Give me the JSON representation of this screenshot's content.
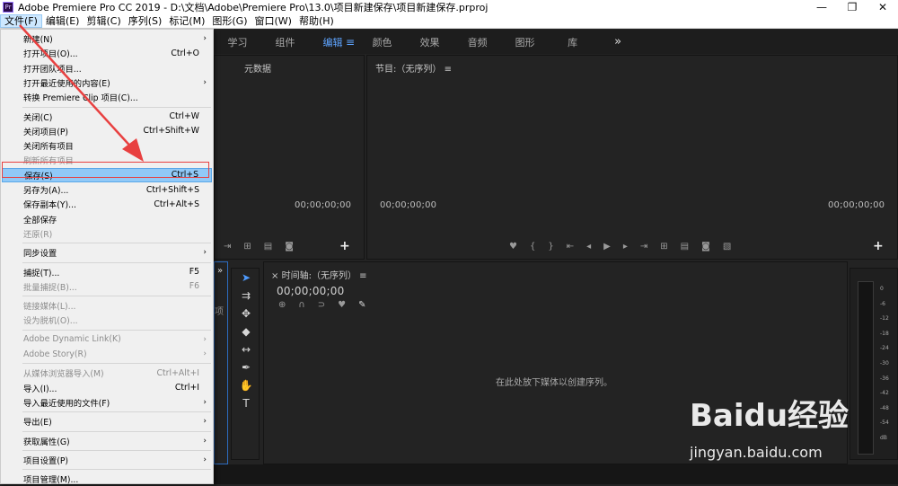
{
  "window": {
    "logo": "Pr",
    "title": "Adobe Premiere Pro CC 2019 - D:\\文档\\Adobe\\Premiere Pro\\13.0\\项目新建保存\\项目新建保存.prproj",
    "controls": [
      "—",
      "❐",
      "✕"
    ]
  },
  "menubar": [
    "文件(F)",
    "编辑(E)",
    "剪辑(C)",
    "序列(S)",
    "标记(M)",
    "图形(G)",
    "窗口(W)",
    "帮助(H)"
  ],
  "workspaces": {
    "tabs": [
      "学习",
      "组件",
      "编辑",
      "颜色",
      "效果",
      "音频",
      "图形",
      "库"
    ],
    "active": "编辑",
    "menu_icon": "≡",
    "more": "»"
  },
  "panels": {
    "source_tab": "元数据",
    "source_timecode": "00;00;00;00",
    "program_tab": "节目:（无序列）",
    "program_tab_menu": "≡",
    "program_timecode_left": "00;00;00;00",
    "program_timecode_right": "00;00;00;00",
    "timeline_close": "×",
    "timeline_tab": "时间轴:（无序列）",
    "timeline_tab_menu": "≡",
    "timeline_timecode": "00;00;00;00",
    "timeline_empty_text": "在此处放下媒体以创建序列。",
    "project_panel_more": "»",
    "project_panel_partial": "项",
    "add_button": "+"
  },
  "meter_scale": [
    "0",
    "-6",
    "-12",
    "-18",
    "-24",
    "-30",
    "-36",
    "-42",
    "-48",
    "-54",
    "dB"
  ],
  "file_menu": [
    {
      "label": "新建(N)",
      "shortcut": "",
      "submenu": true,
      "disabled": false
    },
    {
      "label": "打开项目(O)...",
      "shortcut": "Ctrl+O",
      "submenu": false,
      "disabled": false
    },
    {
      "label": "打开团队项目...",
      "shortcut": "",
      "submenu": false,
      "disabled": false
    },
    {
      "label": "打开最近使用的内容(E)",
      "shortcut": "",
      "submenu": true,
      "disabled": false
    },
    {
      "label": "转换 Premiere Clip 项目(C)...",
      "shortcut": "",
      "submenu": false,
      "disabled": false
    },
    {
      "sep": true
    },
    {
      "label": "关闭(C)",
      "shortcut": "Ctrl+W",
      "submenu": false,
      "disabled": false
    },
    {
      "label": "关闭项目(P)",
      "shortcut": "Ctrl+Shift+W",
      "submenu": false,
      "disabled": false
    },
    {
      "label": "关闭所有项目",
      "shortcut": "",
      "submenu": false,
      "disabled": false
    },
    {
      "label": "刷新所有项目",
      "shortcut": "",
      "submenu": false,
      "disabled": true
    },
    {
      "label": "保存(S)",
      "shortcut": "Ctrl+S",
      "submenu": false,
      "disabled": false,
      "highlight": true
    },
    {
      "label": "另存为(A)...",
      "shortcut": "Ctrl+Shift+S",
      "submenu": false,
      "disabled": false
    },
    {
      "label": "保存副本(Y)...",
      "shortcut": "Ctrl+Alt+S",
      "submenu": false,
      "disabled": false
    },
    {
      "label": "全部保存",
      "shortcut": "",
      "submenu": false,
      "disabled": false
    },
    {
      "label": "还原(R)",
      "shortcut": "",
      "submenu": false,
      "disabled": true
    },
    {
      "sep": true
    },
    {
      "label": "同步设置",
      "shortcut": "",
      "submenu": true,
      "disabled": false
    },
    {
      "sep": true
    },
    {
      "label": "捕捉(T)...",
      "shortcut": "F5",
      "submenu": false,
      "disabled": false
    },
    {
      "label": "批量捕捉(B)...",
      "shortcut": "F6",
      "submenu": false,
      "disabled": true
    },
    {
      "sep": true
    },
    {
      "label": "链接媒体(L)...",
      "shortcut": "",
      "submenu": false,
      "disabled": true
    },
    {
      "label": "设为脱机(O)...",
      "shortcut": "",
      "submenu": false,
      "disabled": true
    },
    {
      "sep": true
    },
    {
      "label": "Adobe Dynamic Link(K)",
      "shortcut": "",
      "submenu": true,
      "disabled": true
    },
    {
      "label": "Adobe Story(R)",
      "shortcut": "",
      "submenu": true,
      "disabled": true
    },
    {
      "sep": true
    },
    {
      "label": "从媒体浏览器导入(M)",
      "shortcut": "Ctrl+Alt+I",
      "submenu": false,
      "disabled": true
    },
    {
      "label": "导入(I)...",
      "shortcut": "Ctrl+I",
      "submenu": false,
      "disabled": false
    },
    {
      "label": "导入最近使用的文件(F)",
      "shortcut": "",
      "submenu": true,
      "disabled": false
    },
    {
      "sep": true
    },
    {
      "label": "导出(E)",
      "shortcut": "",
      "submenu": true,
      "disabled": false
    },
    {
      "sep": true
    },
    {
      "label": "获取属性(G)",
      "shortcut": "",
      "submenu": true,
      "disabled": false
    },
    {
      "sep": true
    },
    {
      "label": "项目设置(P)",
      "shortcut": "",
      "submenu": true,
      "disabled": false
    },
    {
      "sep": true
    },
    {
      "label": "项目管理(M)...",
      "shortcut": "",
      "submenu": false,
      "disabled": false
    }
  ],
  "watermark": {
    "brand": "Baidu经验",
    "url": "jingyan.baidu.com"
  },
  "colors": {
    "accent": "#5ea4ff",
    "annotation": "#e84040",
    "menu_highlight": "#91c9f7"
  }
}
